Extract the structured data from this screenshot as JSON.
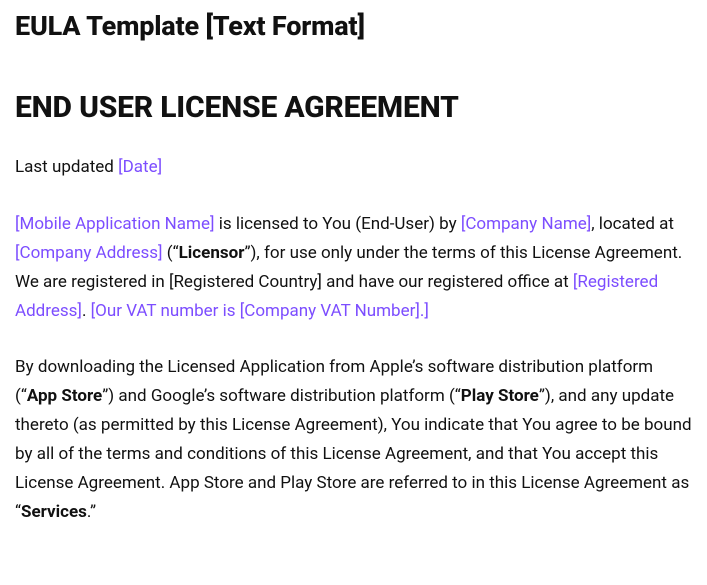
{
  "title": "EULA Template [Text Format]",
  "heading": "END USER LICENSE AGREEMENT",
  "meta_last_updated_label": "Last updated ",
  "meta_date_ph": "[Date]",
  "p1": {
    "app_name_ph": "[Mobile Application Name]",
    "t1": " is licensed to You (End-User) by ",
    "company_name_ph": "[Company Name]",
    "t2": ", located at ",
    "company_address_ph": "[Company Address]",
    "t3": " (“",
    "licensor_bold": "Licensor",
    "t4": "”), for use only under the terms of this License Agreement. We are registered in [Registered Country] and have our registered office at ",
    "registered_address_ph": "[Registered Address]",
    "t5": ". ",
    "vat_ph": "[Our VAT number is [Company VAT Number].]"
  },
  "p2": {
    "t1": "By downloading the Licensed Application from Apple’s software distribution platform (“",
    "appstore_bold": "App Store",
    "t2": "”) and Google’s software distribution platform (“",
    "playstore_bold": "Play Store",
    "t3": "”), and any update thereto (as permitted by this License Agreement), You indicate that You agree to be bound by all of the terms and conditions of this License Agreement, and that You accept this License Agreement. App Store and Play Store are referred to in this License Agreement as “",
    "services_bold": "Services",
    "t4": ".”"
  }
}
